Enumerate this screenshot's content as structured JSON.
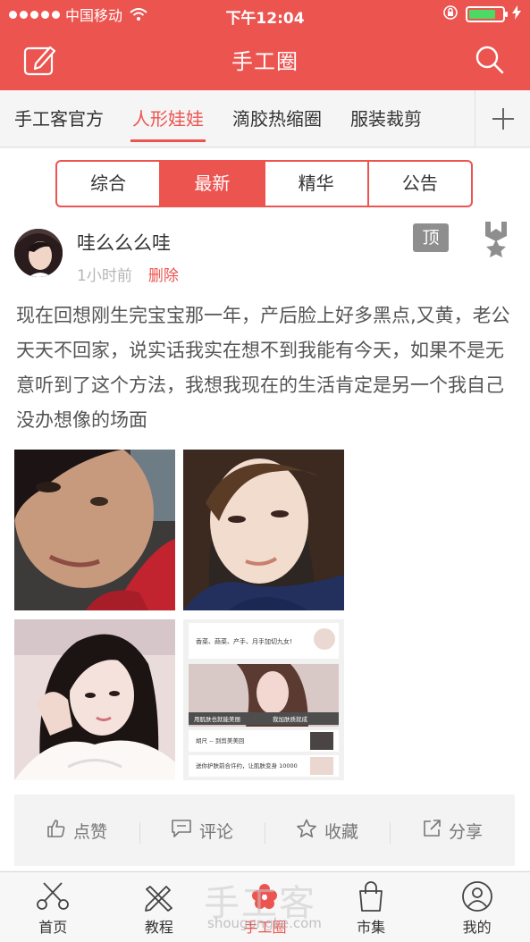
{
  "status_bar": {
    "carrier": "中国移动",
    "time": "下午12:04"
  },
  "header": {
    "title": "手工圈",
    "left_icon": "compose-icon",
    "right_icon": "search-icon"
  },
  "categories": {
    "items": [
      "手工客官方",
      "人形娃娃",
      "滴胶热缩圈",
      "服装裁剪"
    ],
    "active": "人形娃娃",
    "add_icon": "plus-icon"
  },
  "segments": {
    "items": [
      "综合",
      "最新",
      "精华",
      "公告"
    ],
    "active": "最新"
  },
  "post": {
    "username": "哇么么么哇",
    "time_ago": "1小时前",
    "delete_label": "删除",
    "pin_badge": "顶",
    "text": "现在回想刚生完宝宝那一年，产后脸上好多黑点,又黄，老公天天不回家，说实话我实在想不到我能有今天，如果不是无意听到了这个方法，我想我现在的生活肯定是另一个我自己没办想像的场面",
    "screenshot_text": {
      "line1": "香菜、蒜菜、产手、月手加切九女!",
      "banner_left": "用肌肤也就能美丽",
      "banner_right": "我加肤质就成",
      "row1": "胡尺 -- 到剪美美回",
      "row2": "送你护肤前合许约，让肌肤变身 10000"
    }
  },
  "actions": {
    "like": "点赞",
    "comment": "评论",
    "favorite": "收藏",
    "share": "分享"
  },
  "tabbar": {
    "items": [
      {
        "label": "首页",
        "icon": "scissors-icon"
      },
      {
        "label": "教程",
        "icon": "pencil-ruler-icon"
      },
      {
        "label": "手工圈",
        "icon": "flower-icon"
      },
      {
        "label": "市集",
        "icon": "shopping-bag-icon"
      },
      {
        "label": "我的",
        "icon": "user-icon"
      }
    ],
    "active": "手工圈"
  },
  "watermark": {
    "title": "手工客",
    "url": "shougongke.com"
  },
  "colors": {
    "brand": "#ec5450",
    "battery": "#4cd964"
  }
}
